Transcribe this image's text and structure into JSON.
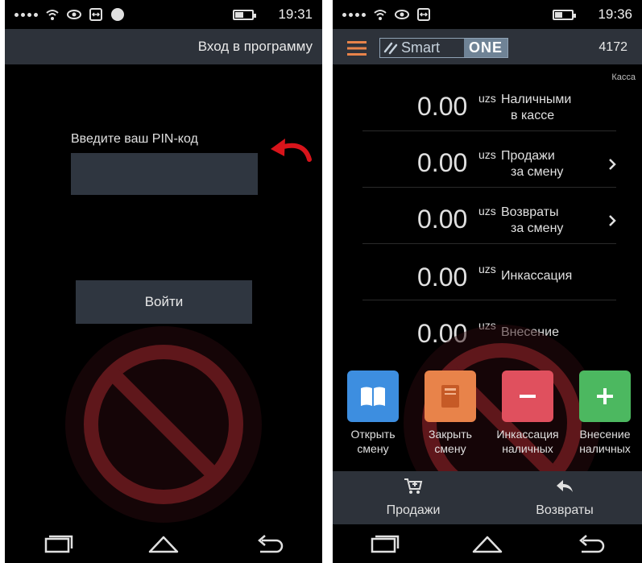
{
  "left_screen": {
    "status": {
      "time": "19:31"
    },
    "header_title": "Вход в программу",
    "pin_label": "Введите ваш PIN-код",
    "pin_value": "",
    "login_button": "Войти"
  },
  "right_screen": {
    "status": {
      "time": "19:36"
    },
    "logo": {
      "smart": "Smart",
      "one": "ONE"
    },
    "store_number": "4172",
    "section_label": "Касса",
    "currency": "uzs",
    "rows": [
      {
        "value": "0.00",
        "label_line1": "Наличными",
        "label_line2": "в кассе",
        "has_chevron": false
      },
      {
        "value": "0.00",
        "label_line1": "Продажи",
        "label_line2": "за смену",
        "has_chevron": true
      },
      {
        "value": "0.00",
        "label_line1": "Возвраты",
        "label_line2": "за смену",
        "has_chevron": true
      },
      {
        "value": "0.00",
        "label_line1": "Инкассация",
        "label_line2": "",
        "has_chevron": false
      },
      {
        "value": "0.00",
        "label_line1": "Внесение",
        "label_line2": "",
        "has_chevron": false
      }
    ],
    "actions": [
      {
        "line1": "Открыть",
        "line2": "смену",
        "color": "#3d8ee0",
        "icon": "book-icon"
      },
      {
        "line1": "Закрыть",
        "line2": "смену",
        "color": "#e8834a",
        "icon": "closed-book-icon"
      },
      {
        "line1": "Инкассация",
        "line2": "наличных",
        "color": "#e0505e",
        "icon": "minus-icon"
      },
      {
        "line1": "Внесение",
        "line2": "наличных",
        "color": "#4cb860",
        "icon": "plus-icon"
      }
    ],
    "bottom_tabs": [
      {
        "label": "Продажи",
        "icon": "cart-add-icon"
      },
      {
        "label": "Возвраты",
        "icon": "return-arrow-icon"
      }
    ]
  },
  "colors": {
    "appbar": "#2d323a",
    "accent_orange": "#e8834a",
    "background": "#000000"
  }
}
